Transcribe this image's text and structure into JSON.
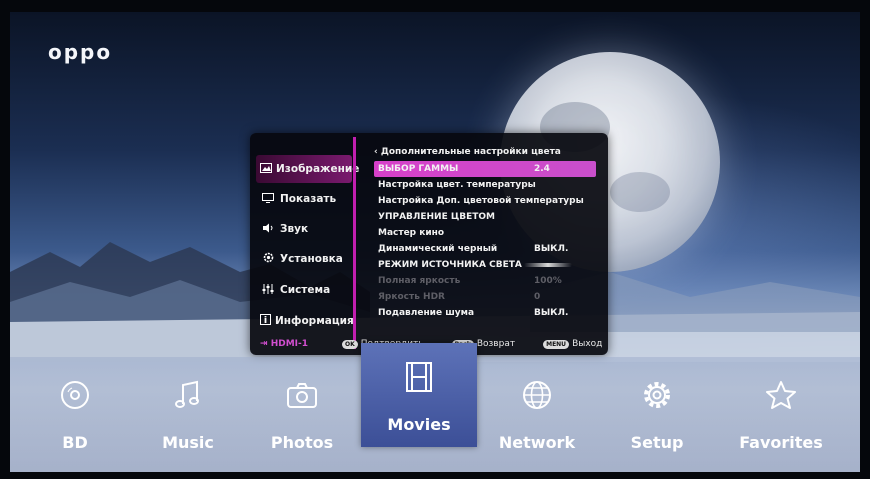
{
  "brand": {
    "logo": "oppo"
  },
  "settings_panel": {
    "sidebar": [
      {
        "icon": "picture-icon",
        "label": "Изображение",
        "active": true
      },
      {
        "icon": "display-icon",
        "label": "Показать",
        "active": false
      },
      {
        "icon": "speaker-icon",
        "label": "Звук",
        "active": false
      },
      {
        "icon": "gear-icon",
        "label": "Установка",
        "active": false
      },
      {
        "icon": "sliders-icon",
        "label": "Система",
        "active": false
      },
      {
        "icon": "info-icon",
        "label": "Информация",
        "active": false
      }
    ],
    "input_source": "HDMI-1",
    "breadcrumb": "Дополнительные настройки цвета",
    "rows": [
      {
        "label": "ВЫБОР ГАММЫ",
        "value": "2.4",
        "active": true
      },
      {
        "label": "Настройка цвет. температуры",
        "value": ""
      },
      {
        "label": "Настройка Доп. цветовой температуры",
        "value": ""
      },
      {
        "label": "УПРАВЛЕНИЕ ЦВЕТОМ",
        "value": ""
      },
      {
        "label": "Мастер кино",
        "value": ""
      },
      {
        "label": "Динамический черный",
        "value": "ВЫКЛ."
      },
      {
        "label": "РЕЖИМ ИСТОЧНИКА СВЕТА",
        "value": ""
      },
      {
        "label": "Полная яркость",
        "value": "100%",
        "dim": true
      },
      {
        "label": "Яркость HDR",
        "value": "0",
        "dim": true
      },
      {
        "label": "Подавление шума",
        "value": "ВЫКЛ."
      }
    ],
    "footer": {
      "ok_key": "OK",
      "ok_label": "Подтвердить",
      "back_key": "Back",
      "back_label": "Возврат",
      "menu_key": "MENU",
      "menu_label": "Выход"
    }
  },
  "menubar": {
    "items": [
      {
        "icon": "disc-icon",
        "label": "BD"
      },
      {
        "icon": "music-note-icon",
        "label": "Music"
      },
      {
        "icon": "camera-icon",
        "label": "Photos"
      },
      {
        "icon": "film-icon",
        "label": "Movies",
        "active": true
      },
      {
        "icon": "globe-icon",
        "label": "Network"
      },
      {
        "icon": "gear-icon",
        "label": "Setup"
      },
      {
        "icon": "star-icon",
        "label": "Favorites"
      }
    ]
  }
}
